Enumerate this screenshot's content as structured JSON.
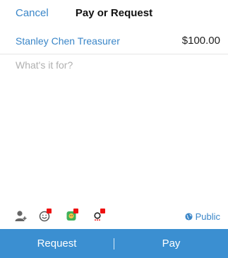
{
  "header": {
    "cancel_label": "Cancel",
    "title": "Pay or Request"
  },
  "payment": {
    "recipient": "Stanley Chen Treasurer",
    "amount": "$100.00"
  },
  "note": {
    "placeholder": "What's it for?",
    "value": ""
  },
  "toolbar": {
    "icons": [
      "person-add-icon",
      "emoji-icon",
      "sticker-icon",
      "special-character-icon"
    ],
    "privacy_label": "Public"
  },
  "actions": {
    "request_label": "Request",
    "pay_label": "Pay"
  },
  "colors": {
    "accent": "#3a86c8",
    "action_bar": "#3b8fd1",
    "badge": "#ee1111"
  }
}
